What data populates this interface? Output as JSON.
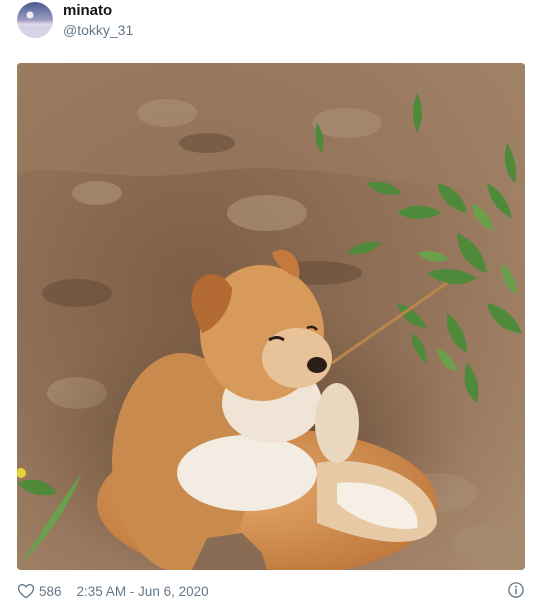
{
  "author": {
    "display_name": "minato",
    "handle": "@tokky_31"
  },
  "media": {
    "alt": "A fluffy orange and white dog lying curled in a dug hole of dirt with weeds nearby"
  },
  "footer": {
    "like_count": "586",
    "timestamp": "2:35 AM - Jun 6, 2020"
  },
  "icons": {
    "like": "heart-outline-icon",
    "info": "info-circle-icon"
  },
  "colors": {
    "name": "#14171a",
    "meta": "#657786"
  }
}
